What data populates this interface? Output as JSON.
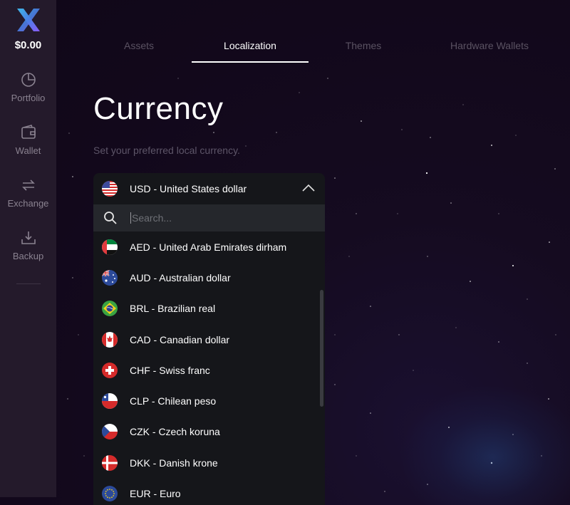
{
  "sidebar": {
    "balance": "$0.00",
    "items": [
      {
        "label": "Portfolio",
        "icon": "pie-chart-icon"
      },
      {
        "label": "Wallet",
        "icon": "wallet-icon"
      },
      {
        "label": "Exchange",
        "icon": "exchange-arrows-icon"
      },
      {
        "label": "Backup",
        "icon": "download-tray-icon"
      }
    ]
  },
  "tabs": [
    {
      "label": "Assets",
      "active": false
    },
    {
      "label": "Localization",
      "active": true
    },
    {
      "label": "Themes",
      "active": false
    },
    {
      "label": "Hardware Wallets",
      "active": false
    }
  ],
  "page": {
    "title": "Currency",
    "subtitle": "Set your preferred local currency."
  },
  "currency_select": {
    "selected": "USD - United States dollar",
    "search_placeholder": "Search...",
    "options": [
      "AED - United Arab Emirates dirham",
      "AUD - Australian dollar",
      "BRL - Brazilian real",
      "CAD - Canadian dollar",
      "CHF - Swiss franc",
      "CLP - Chilean peso",
      "CZK - Czech koruna",
      "DKK - Danish krone",
      "EUR - Euro"
    ]
  },
  "colors": {
    "background": "#12081b",
    "sidebar": "#241a2b",
    "dropdown": "#15161a",
    "search_bar": "#25272c",
    "logo_blue": "#4a7fe6",
    "logo_purple": "#8b5cf6"
  }
}
